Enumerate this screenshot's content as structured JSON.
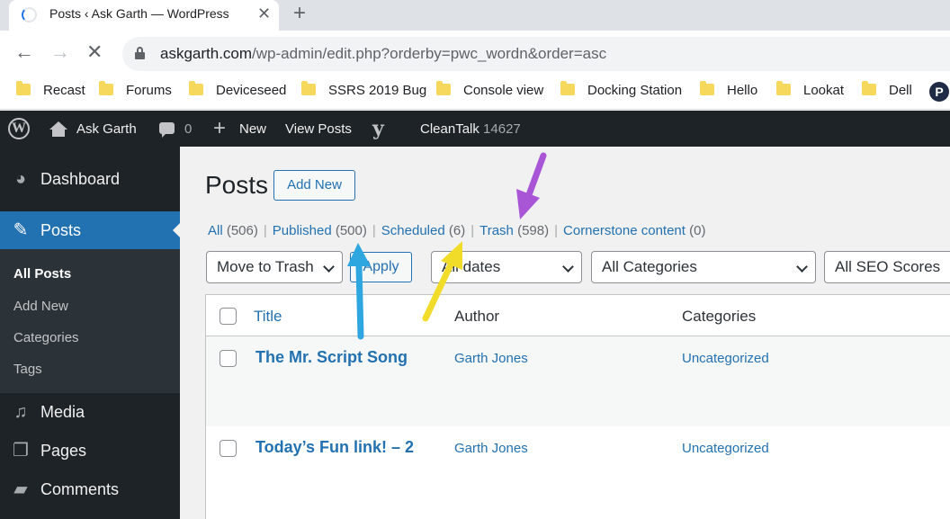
{
  "browser": {
    "tab_title": "Posts ‹ Ask Garth — WordPress",
    "tab_close": "✕",
    "new_tab": "+",
    "url_host": "askgarth.com",
    "url_path": "/wp-admin/edit.php?orderby=pwc_wordn&order=asc",
    "bookmarks": [
      "Recast",
      "Forums",
      "Deviceseed",
      "SSRS 2019 Bug",
      "Console view",
      "Docking Station",
      "Hello",
      "Lookat",
      "Dell"
    ],
    "bookmark_profile_letter": "P"
  },
  "adminbar": {
    "site_name": "Ask Garth",
    "comments_count": "0",
    "new_label": "New",
    "view_posts": "View Posts",
    "cleantalk_label": "CleanTalk",
    "cleantalk_count": "14627"
  },
  "sidebar": {
    "dashboard": "Dashboard",
    "posts": "Posts",
    "submenu": [
      "All Posts",
      "Add New",
      "Categories",
      "Tags"
    ],
    "media": "Media",
    "pages": "Pages",
    "comments": "Comments"
  },
  "main": {
    "title": "Posts",
    "add_new": "Add New",
    "filters": [
      {
        "label": "All",
        "count": "(506)"
      },
      {
        "label": "Published",
        "count": "(500)"
      },
      {
        "label": "Scheduled",
        "count": "(6)"
      },
      {
        "label": "Trash",
        "count": "(598)"
      },
      {
        "label": "Cornerstone content",
        "count": "(0)"
      }
    ],
    "bulk_action": "Move to Trash",
    "apply": "Apply",
    "dates_filter": "All dates",
    "categories_filter": "All Categories",
    "seo_filter": "All SEO Scores",
    "columns": {
      "title": "Title",
      "author": "Author",
      "categories": "Categories"
    },
    "rows": [
      {
        "title": "The Mr. Script Song",
        "author": "Garth Jones",
        "category": "Uncategorized"
      },
      {
        "title": "Today’s Fun link! – 2",
        "author": "Garth Jones",
        "category": "Uncategorized"
      }
    ]
  },
  "annotations": {
    "colors": {
      "purple": "#a855d6",
      "blue": "#2ea6e0",
      "yellow": "#f2dc2a"
    }
  }
}
